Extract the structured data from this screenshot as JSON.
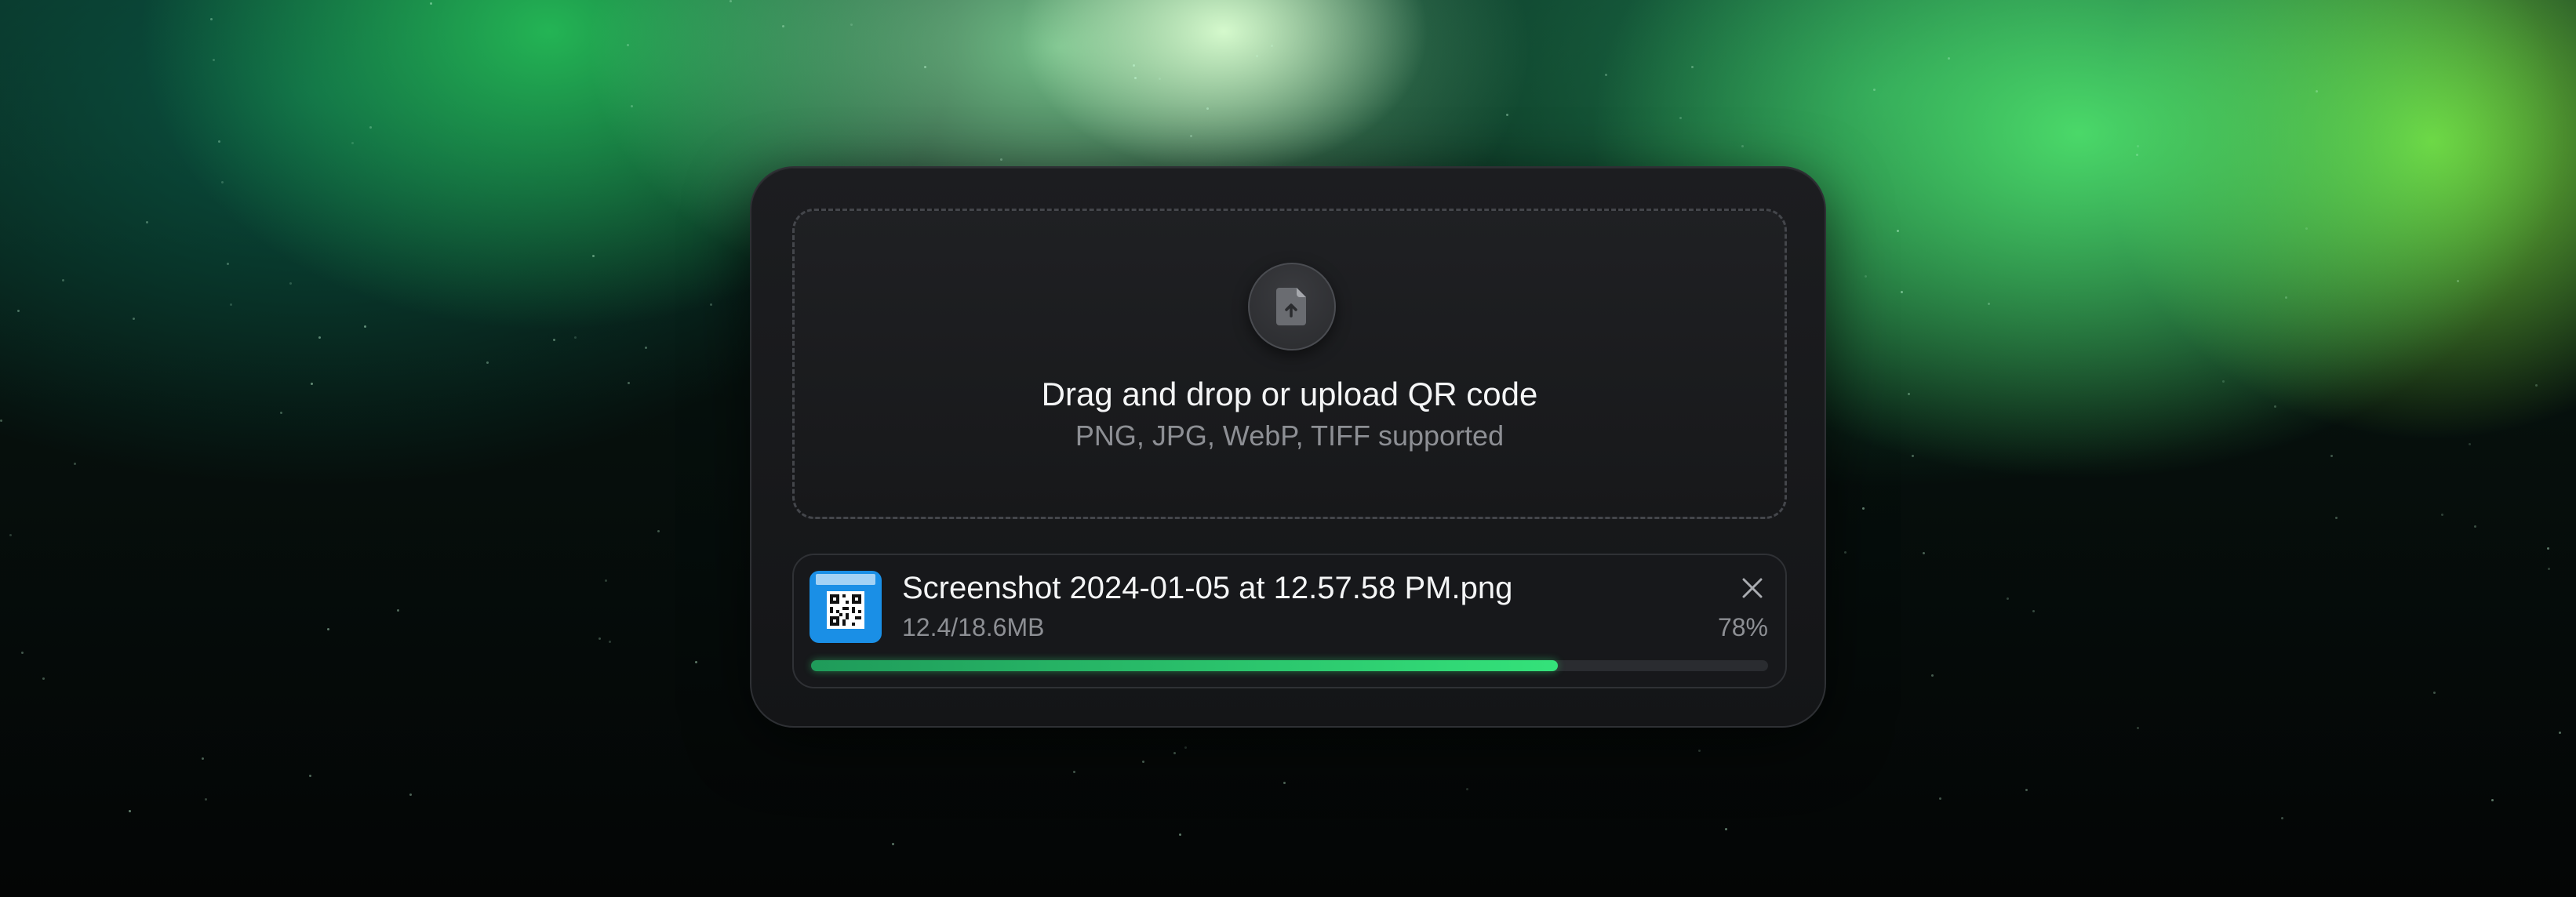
{
  "dropzone": {
    "icon": "file-upload-icon",
    "title": "Drag and drop or upload QR code",
    "subtitle": "PNG, JPG, WebP, TIFF supported"
  },
  "file": {
    "name": "Screenshot 2024-01-05 at 12.57.58 PM.png",
    "size": "12.4/18.6MB",
    "percent_label": "78%",
    "progress": 0.78,
    "thumbnail_icon": "qr-code-thumbnail",
    "remove_icon": "close-icon"
  },
  "colors": {
    "accent": "#34e27a",
    "thumbnail_bg": "#1a8fe6",
    "card_bg": "#17181b"
  }
}
